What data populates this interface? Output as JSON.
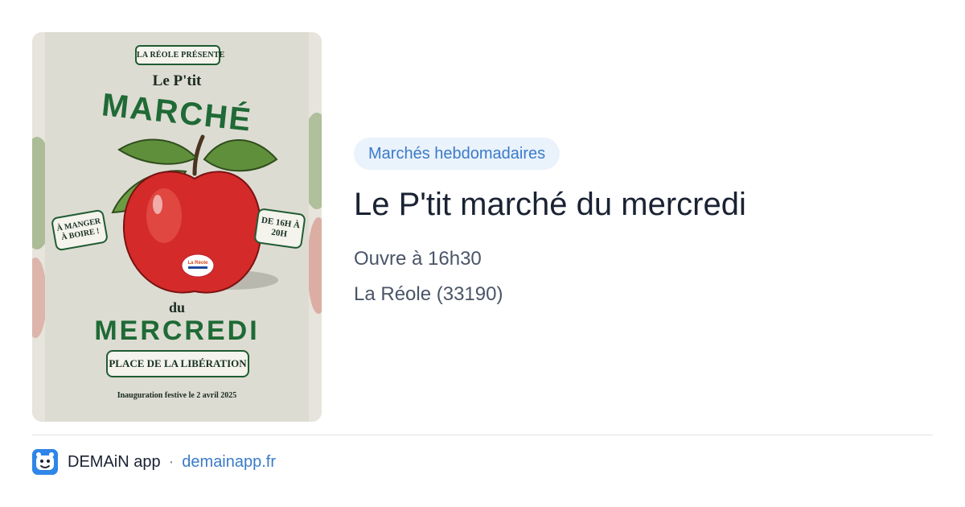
{
  "poster": {
    "presente": "LA RÉOLE PRÉSENTE",
    "ptit": "Le P'tit",
    "marche": "MARCHÉ",
    "badge_left": "À MANGER À BOIRE !",
    "badge_right": "DE 16H À 20H",
    "apple_sticker": "La Réole",
    "du": "du",
    "mercredi": "MERCREDI",
    "place": "PLACE DE LA LIBÉRATION",
    "inauguration": "Inauguration festive le 2 avril 2025"
  },
  "event": {
    "category": "Marchés hebdomadaires",
    "title": "Le P'tit marché du mercredi",
    "hours": "Ouvre à 16h30",
    "location": "La Réole (33190)"
  },
  "footer": {
    "app_name": "DEMAiN app",
    "separator": "·",
    "domain": "demainapp.fr"
  },
  "colors": {
    "accent": "#3a7bc8",
    "category_bg": "#eaf2fb",
    "title": "#1a2233",
    "meta": "#4a5568",
    "poster_green": "#1f6a36",
    "apple_red": "#d42a2a",
    "app_icon": "#2f86e8"
  },
  "icons": {
    "app_icon": "demain-app-logo-icon"
  }
}
